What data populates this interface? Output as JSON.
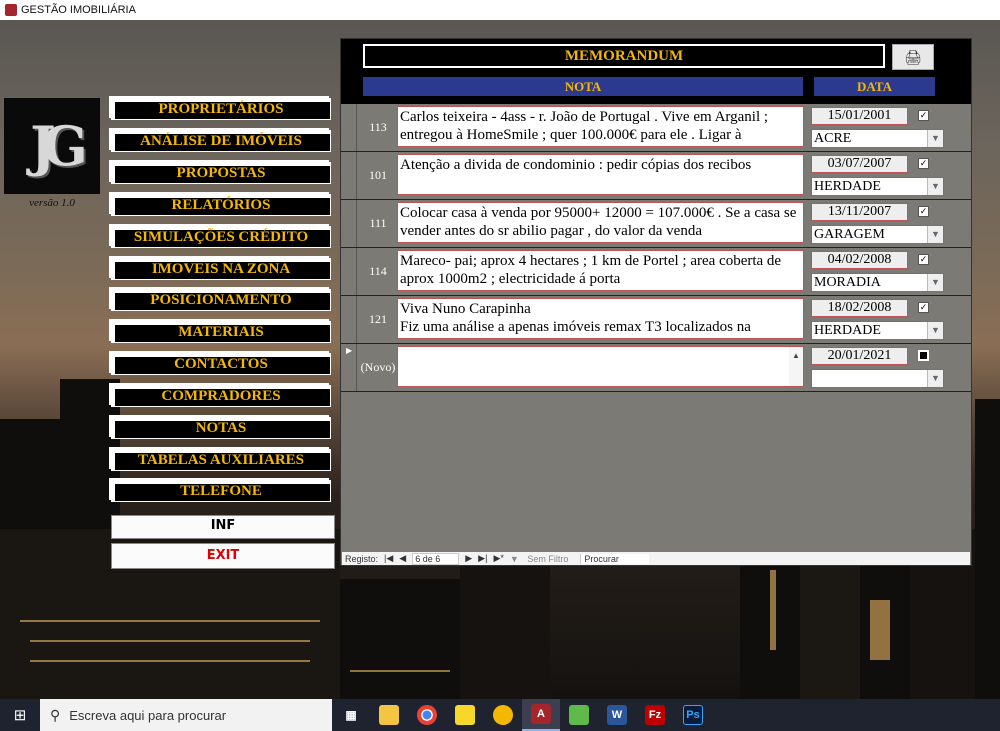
{
  "window": {
    "title": "GESTÃO IMOBILIÁRIA"
  },
  "sidebar": {
    "version": "versão 1.0",
    "buttons": [
      "PROPRIETÁRIOS",
      "ANÁLISE DE IMÓVEIS",
      "PROPOSTAS",
      "RELATÓRIOS",
      "SIMULAÇÕES CRÉDITO",
      "IMOVEIS NA ZONA",
      "POSICIONAMENTO",
      "MATERIAIS",
      "CONTACTOS",
      "COMPRADORES",
      "NOTAS",
      "TABELAS AUXILIARES",
      "TELEFONE"
    ],
    "inf_label": "INF",
    "exit_label": "EXIT"
  },
  "form": {
    "title": "MEMORANDUM",
    "col_nota": "NOTA",
    "col_data": "DATA",
    "records": [
      {
        "id": "113",
        "note": "Carlos teixeira - 4ass - r. João de Portugal . Vive em Arganil ; entregou à HomeSmile ; quer 100.000€ para ele . Ligar à",
        "date": "15/01/2001",
        "checked": true,
        "category": "ACRE"
      },
      {
        "id": "101",
        "note": "Atenção a divida de condominio : pedir cópias dos recibos",
        "date": "03/07/2007",
        "checked": true,
        "category": "HERDADE"
      },
      {
        "id": "111",
        "note": "Colocar casa à venda por 95000+ 12000 = 107.000€ . Se a casa se vender antes do sr abilio pagar , do valor da venda",
        "date": "13/11/2007",
        "checked": true,
        "category": "GARAGEM"
      },
      {
        "id": "114",
        "note": "Mareco- pai; aprox 4 hectares ; 1 km de Portel ; area coberta de aprox 1000m2 ; electricidade á porta",
        "date": "04/02/2008",
        "checked": true,
        "category": "MORADIA"
      },
      {
        "id": "121",
        "note": "Viva Nuno Carapinha\nFiz uma análise a apenas imóveis remax T3 localizados na",
        "date": "18/02/2008",
        "checked": true,
        "category": "HERDADE"
      }
    ],
    "new_record": {
      "id": "(Novo)",
      "note": "",
      "date": "20/01/2021",
      "category": ""
    },
    "navigation": {
      "label": "Registo:",
      "position": "6 de 6",
      "filter": "Sem Filtro",
      "search": "Procurar"
    }
  },
  "taskbar": {
    "search_placeholder": "Escreva aqui para procurar"
  }
}
